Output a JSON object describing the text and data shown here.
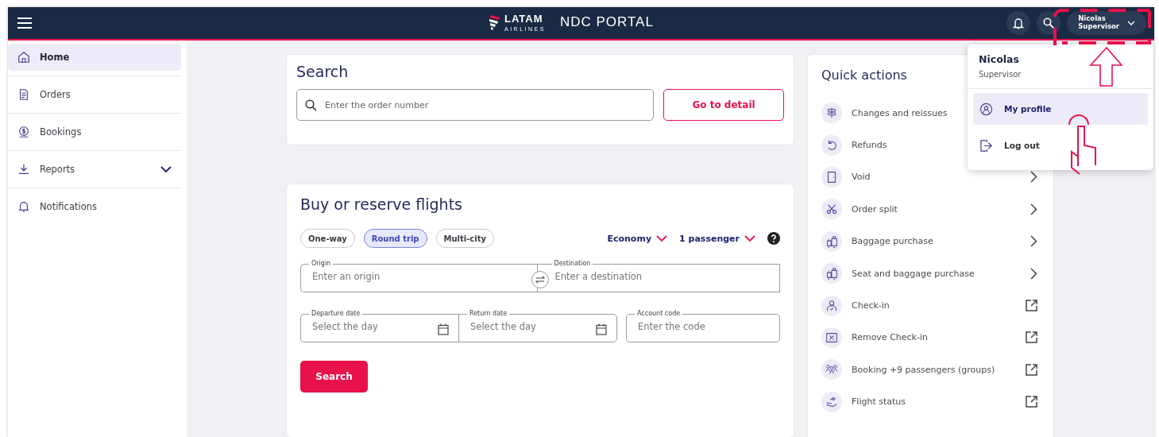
{
  "header": {
    "brand": "LATAM",
    "brand_sub": "AIRLINES",
    "portal": "NDC PORTAL",
    "user": {
      "name": "Nicolas",
      "role": "Supervisor"
    }
  },
  "sidebar": {
    "items": [
      {
        "label": "Home",
        "selected": true,
        "expandable": false
      },
      {
        "label": "Orders",
        "selected": false,
        "expandable": false
      },
      {
        "label": "Bookings",
        "selected": false,
        "expandable": false
      },
      {
        "label": "Reports",
        "selected": false,
        "expandable": true
      },
      {
        "label": "Notifications",
        "selected": false,
        "expandable": false
      }
    ]
  },
  "search": {
    "title": "Search",
    "placeholder": "Enter the order number",
    "button": "Go to detail"
  },
  "booking": {
    "title": "Buy or reserve flights",
    "trip_types": [
      {
        "label": "One-way",
        "selected": false
      },
      {
        "label": "Round trip",
        "selected": true
      },
      {
        "label": "Multi-city",
        "selected": false
      }
    ],
    "cabin": "Economy",
    "passengers": "1 passenger",
    "origin": {
      "label": "Origin",
      "placeholder": "Enter an origin"
    },
    "destination": {
      "label": "Destination",
      "placeholder": "Enter a destination"
    },
    "departure": {
      "label": "Departure date",
      "placeholder": "Select the day"
    },
    "return": {
      "label": "Return date",
      "placeholder": "Select the day"
    },
    "account": {
      "label": "Account code",
      "placeholder": "Enter the code"
    },
    "button": "Search"
  },
  "quick_actions": {
    "title": "Quick actions",
    "items": [
      {
        "label": "Changes and reissues",
        "kind": "plain"
      },
      {
        "label": "Refunds",
        "kind": "plain"
      },
      {
        "label": "Void",
        "kind": "submenu"
      },
      {
        "label": "Order split",
        "kind": "submenu"
      },
      {
        "label": "Baggage purchase",
        "kind": "submenu"
      },
      {
        "label": "Seat and baggage purchase",
        "kind": "submenu"
      },
      {
        "label": "Check-in",
        "kind": "external"
      },
      {
        "label": "Remove Check-in",
        "kind": "external"
      },
      {
        "label": "Booking +9 passengers (groups)",
        "kind": "external"
      },
      {
        "label": "Flight status",
        "kind": "external"
      }
    ]
  },
  "user_menu": {
    "name": "Nicolas",
    "role": "Supervisor",
    "items": [
      {
        "label": "My profile",
        "selected": true
      },
      {
        "label": "Log out",
        "selected": false
      }
    ]
  }
}
